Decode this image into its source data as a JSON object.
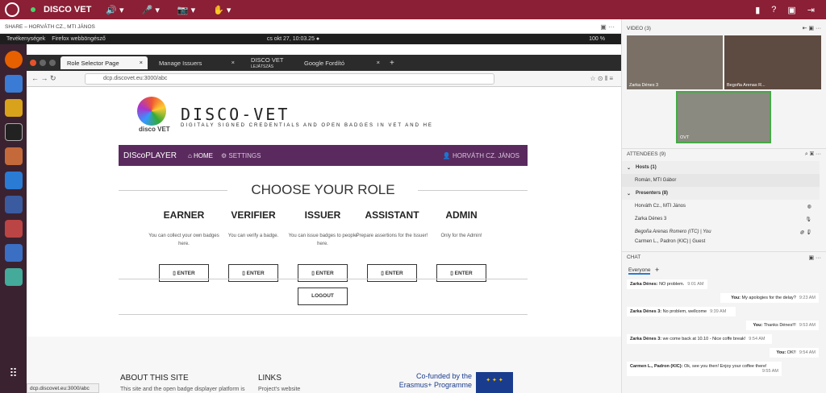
{
  "topbar": {
    "title": "DISCO VET"
  },
  "share": {
    "label": "SHARE – HORVÁTH CZ., MTI JÁNOS"
  },
  "ubuntu": {
    "activities": "Tevékenységek",
    "app": "Firefox webböngésző",
    "clock": "cs okt 27, 10:03.25 ●",
    "battery": "100 %"
  },
  "browser": {
    "tabs": [
      "Role Selector Page",
      "Manage Issuers",
      "DISCO VET",
      "Google Fordító"
    ],
    "tab3_sub": "LEJÁTSZÁS",
    "url": "dcp.discovet.eu:3000/abc"
  },
  "site": {
    "brand": "DISCO-VET",
    "tagline": "DIGITALY SIGNED CREDENTIALS AND OPEN BADGES IN VET AND HE",
    "logo_text": "disco VET",
    "nav": {
      "brand": "DIScoPLAYER",
      "home": "HOME",
      "settings": "SETTINGS",
      "user": "HORVÁTH CZ. JÁNOS"
    },
    "choose": "CHOOSE YOUR ROLE",
    "roles": [
      {
        "name": "EARNER",
        "desc": "You can collect your own badges here.",
        "btn": "ENTER"
      },
      {
        "name": "VERIFIER",
        "desc": "You can verify a badge.",
        "btn": "ENTER"
      },
      {
        "name": "ISSUER",
        "desc": "You can issue badges to people here.",
        "btn": "ENTER"
      },
      {
        "name": "ASSISTANT",
        "desc": "Prepare assertions for the Issuer!",
        "btn": "ENTER"
      },
      {
        "name": "ADMIN",
        "desc": "Only for the Admin!",
        "btn": "ENTER"
      }
    ],
    "logout": "LOGOUT",
    "footer": {
      "about": "ABOUT THIS SITE",
      "links": "LINKS",
      "about_text": "This site and the open badge displayer platform is",
      "links_text": "Project's website",
      "cofunded": "Co-funded by the",
      "programme": "Erasmus+ Programme"
    }
  },
  "status": "dcp.discovet.eu:3000/abc",
  "video": {
    "title": "VIDEO (3)",
    "p1": "Zarka Dénes 3",
    "p2": "Begoña Arenas R...",
    "p3": "OVT"
  },
  "attendees": {
    "title": "ATTENDEES (9)",
    "hosts": "Hosts (1)",
    "host1": "Román, MTI Gábor",
    "presenters": "Presenters (8)",
    "list": [
      "Horváth Cz., MTI János",
      "Zarka Dénes 3",
      "Begoña Arenas Romero (ITC) | You",
      "Carmen L., Padron (KIC) | Guest"
    ]
  },
  "chat": {
    "title": "CHAT",
    "tab": "Everyone",
    "messages": [
      {
        "from": "Zarka Dénes:",
        "text": "NO problem.",
        "time": "9:01 AM"
      },
      {
        "from": "You:",
        "text": "My apologies for the delay?",
        "time": "9:23 AM"
      },
      {
        "from": "Zarka Dénes 3:",
        "text": "No problem, wellcome",
        "time": "9:39 AM"
      },
      {
        "from": "You:",
        "text": "Thanks Dénes!!!",
        "time": "9:53 AM"
      },
      {
        "from": "Zarka Dénes 3:",
        "text": "we come back at 10.10 - Nice coffe break!",
        "time": "9:54 AM"
      },
      {
        "from": "You:",
        "text": "OK!!",
        "time": "9:54 AM"
      },
      {
        "from": "Carmen L., Padron (KIC):",
        "text": "Ok, see you then! Enjoy your coffee there!",
        "time": "9:55 AM"
      }
    ]
  }
}
